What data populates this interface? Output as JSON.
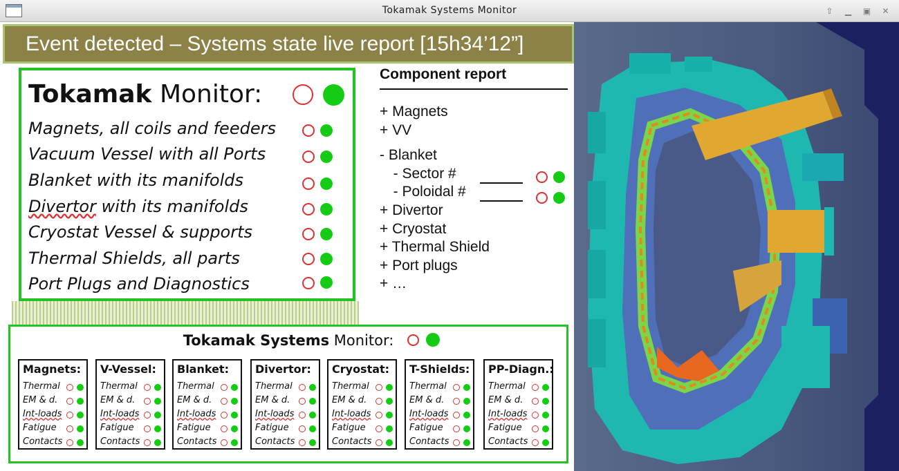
{
  "window": {
    "title": "Tokamak Systems Monitor",
    "controls": [
      {
        "name": "roll-up-icon",
        "glyph": "⇧"
      },
      {
        "name": "minimize-icon",
        "glyph": "▁"
      },
      {
        "name": "maximize-icon",
        "glyph": "▣"
      },
      {
        "name": "close-icon",
        "glyph": "✕"
      }
    ]
  },
  "banner": {
    "text": "Event detected  – Systems state live report [15h34’12”]"
  },
  "tokamak_monitor": {
    "heading_bold": "Tokamak",
    "heading_rest": " Monitor:",
    "items": [
      {
        "text": "Magnets, all coils and feeders",
        "status": "ok"
      },
      {
        "text": "Vacuum Vessel with all Ports",
        "status": "ok"
      },
      {
        "text": "Blanket with its manifolds",
        "status": "ok"
      },
      {
        "text_underlined": "Divertor",
        "text_rest": " with its manifolds",
        "status": "ok"
      },
      {
        "text": "Cryostat Vessel & supports",
        "status": "ok"
      },
      {
        "text": "Thermal Shields, all parts",
        "status": "ok"
      },
      {
        "text": "Port Plugs and Diagnostics",
        "status": "ok"
      }
    ]
  },
  "component_report": {
    "title": "Component report",
    "items": [
      {
        "text": "+ Magnets"
      },
      {
        "text": "+ VV"
      },
      {
        "text": "- Blanket"
      },
      {
        "text": "  - Sector #",
        "status": "ok"
      },
      {
        "text": "  - Poloidal #",
        "status": "ok"
      },
      {
        "text": "+ Divertor"
      },
      {
        "text": "+ Cryostat"
      },
      {
        "text": "+ Thermal Shield"
      },
      {
        "text": "+ Port plugs"
      },
      {
        "text": "+ …"
      }
    ]
  },
  "systems_monitor": {
    "heading_bold": "Tokamak Systems",
    "heading_rest": " Monitor:",
    "row_labels": [
      "Thermal",
      "EM & d.",
      "Int-loads",
      "Fatigue",
      "Contacts"
    ],
    "cards": [
      {
        "title": "Magnets:",
        "status": [
          "ok",
          "ok",
          "ok",
          "ok",
          "ok"
        ]
      },
      {
        "title": "V-Vessel:",
        "status": [
          "ok",
          "ok",
          "ok",
          "ok",
          "ok"
        ]
      },
      {
        "title": "Blanket:",
        "status": [
          "ok",
          "ok",
          "ok",
          "ok",
          "ok"
        ]
      },
      {
        "title": "Divertor:",
        "status": [
          "ok",
          "ok",
          "ok",
          "ok",
          "ok"
        ]
      },
      {
        "title": "Cryostat:",
        "status": [
          "ok",
          "ok",
          "ok",
          "ok",
          "ok"
        ]
      },
      {
        "title": "T-Shields:",
        "status": [
          "ok",
          "ok",
          "ok",
          "ok",
          "ok"
        ]
      },
      {
        "title": "PP-Diagn.:",
        "status": [
          "ok",
          "ok",
          "ok",
          "ok",
          "ok"
        ]
      }
    ]
  },
  "colors": {
    "banner_bg": "#8c8146",
    "banner_border": "#a8c46c",
    "box_border": "#22c322",
    "indicator_on": "#14cc14",
    "indicator_off": "#e03030",
    "model_teal": "#1fb8b0",
    "model_blue": "#4f6fb8",
    "model_orange": "#e0a830",
    "model_dark": "#1a2060"
  }
}
